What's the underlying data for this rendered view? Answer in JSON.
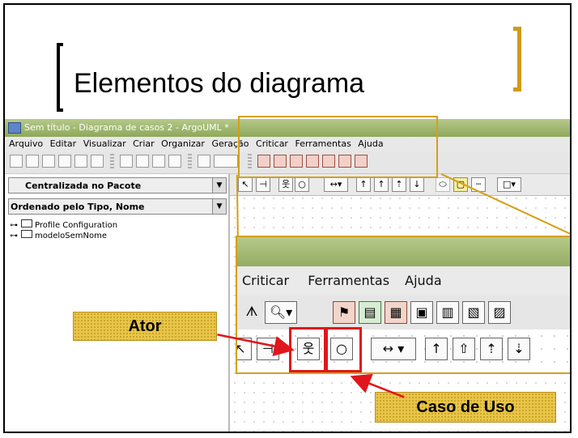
{
  "slide": {
    "title": "Elementos do diagrama"
  },
  "window": {
    "title": "Sem título - Diagrama de casos 2 - ArgoUML *"
  },
  "menubar": {
    "items": [
      "Arquivo",
      "Editar",
      "Visualizar",
      "Criar",
      "Organizar",
      "Geração",
      "Criticar",
      "Ferramentas",
      "Ajuda"
    ]
  },
  "left_panel": {
    "perspective": "Centralizada no Pacote",
    "order": "Ordenado pelo Tipo, Nome",
    "tree": [
      "Profile Configuration",
      "modeloSemNome"
    ]
  },
  "zoom": {
    "menu_items": [
      "Criticar",
      "Ferramentas",
      "Ajuda"
    ]
  },
  "callouts": {
    "actor": "Ator",
    "use_case": "Caso de Uso"
  },
  "colors": {
    "accent_bracket": "#d19a17",
    "highlight": "#e0161c",
    "label_bg": "#e9c648",
    "titlebar": "#9fb76d"
  }
}
